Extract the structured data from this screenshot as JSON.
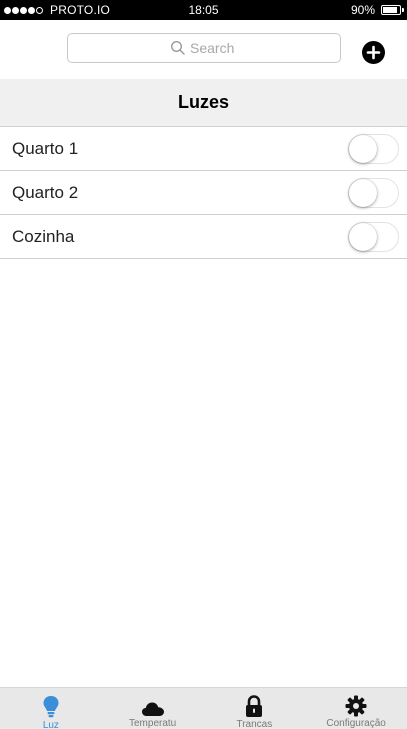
{
  "status_bar": {
    "carrier": "PROTO.IO",
    "time": "18:05",
    "battery": "90%",
    "battery_level": 0.9,
    "signal_bars": 4
  },
  "search": {
    "placeholder": "Search",
    "value": ""
  },
  "nav": {
    "title": "Luzes"
  },
  "lights": [
    {
      "label": "Quarto 1",
      "on": false
    },
    {
      "label": "Quarto 2",
      "on": false
    },
    {
      "label": "Cozinha",
      "on": false
    }
  ],
  "tabs": [
    {
      "label": "Luz",
      "icon": "lightbulb-icon",
      "active": true
    },
    {
      "label": "Temperatu",
      "icon": "cloud-icon",
      "active": false
    },
    {
      "label": "Trancas",
      "icon": "lock-icon",
      "active": false
    },
    {
      "label": "Configuração",
      "icon": "gear-icon",
      "active": false
    }
  ],
  "colors": {
    "accent": "#3a8fd8",
    "tab_bar": "#e8e8e8",
    "nav_bar": "#f0f0f0"
  }
}
